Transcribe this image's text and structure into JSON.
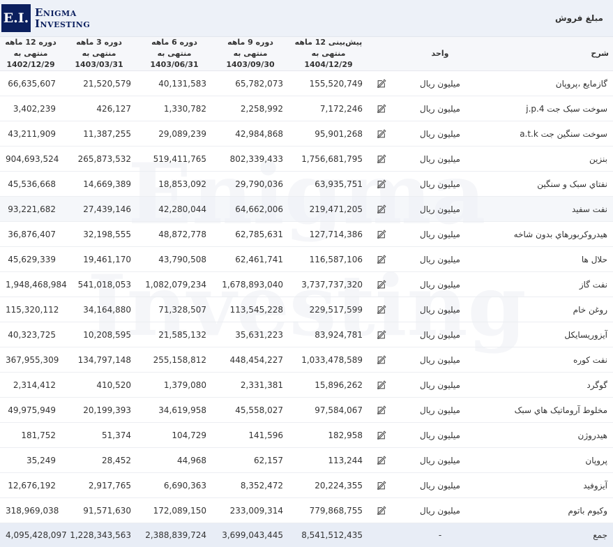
{
  "logo": {
    "box": "E.I.",
    "line1": "Enigma",
    "line2": "Investing"
  },
  "section_title": "مبلغ فروش",
  "columns": {
    "desc": "شرح",
    "unit": "واحد",
    "forecast": "پیش‌بینی 12 ماهه منتهی به 1404/12/29",
    "p9": "دوره 9 ماهه منتهی به 1403/09/30",
    "p6": "دوره 6 ماهه منتهی به 1403/06/31",
    "p3": "دوره 3 ماهه منتهی به 1403/03/31",
    "p12": "دوره 12 ماهه منتهی به 1402/12/29"
  },
  "rows": [
    {
      "desc": "گازمایع ،پروپان",
      "unit": "میلیون ریال",
      "forecast": "155,520,749",
      "p9": "65,782,073",
      "p6": "40,131,583",
      "p3": "21,520,579",
      "p12": "66,635,607"
    },
    {
      "desc": "سوخت سبک جت j.p.4",
      "unit": "میلیون ریال",
      "forecast": "7,172,246",
      "p9": "2,258,992",
      "p6": "1,330,782",
      "p3": "426,127",
      "p12": "3,402,239"
    },
    {
      "desc": "سوخت سنگین جت a.t.k",
      "unit": "میلیون ریال",
      "forecast": "95,901,268",
      "p9": "42,984,868",
      "p6": "29,089,239",
      "p3": "11,387,255",
      "p12": "43,211,909"
    },
    {
      "desc": "بنزین",
      "unit": "میلیون ریال",
      "forecast": "1,756,681,795",
      "p9": "802,339,433",
      "p6": "519,411,765",
      "p3": "265,873,532",
      "p12": "904,693,524"
    },
    {
      "desc": "نفتاي سبک و سنگين",
      "unit": "میلیون ریال",
      "forecast": "63,935,751",
      "p9": "29,790,036",
      "p6": "18,853,092",
      "p3": "14,669,389",
      "p12": "45,536,668"
    },
    {
      "desc": "نفت سفيد",
      "unit": "میلیون ریال",
      "forecast": "219,471,205",
      "p9": "64,662,006",
      "p6": "42,280,044",
      "p3": "27,439,146",
      "p12": "93,221,682"
    },
    {
      "desc": "هيدروکربورهاي بدون شاخه",
      "unit": "میلیون ریال",
      "forecast": "127,714,386",
      "p9": "62,785,631",
      "p6": "48,872,778",
      "p3": "32,198,555",
      "p12": "36,876,407"
    },
    {
      "desc": "حلال ها",
      "unit": "میلیون ریال",
      "forecast": "116,587,106",
      "p9": "62,461,741",
      "p6": "43,790,508",
      "p3": "19,461,170",
      "p12": "45,629,339"
    },
    {
      "desc": "نفت گاز",
      "unit": "میلیون ریال",
      "forecast": "3,737,737,320",
      "p9": "1,678,893,040",
      "p6": "1,082,079,234",
      "p3": "541,018,053",
      "p12": "1,948,468,984"
    },
    {
      "desc": "روغن خام",
      "unit": "میلیون ریال",
      "forecast": "229,517,599",
      "p9": "113,545,228",
      "p6": "71,328,507",
      "p3": "34,164,880",
      "p12": "115,320,112"
    },
    {
      "desc": "آيزوريسايکل",
      "unit": "میلیون ریال",
      "forecast": "83,924,781",
      "p9": "35,631,223",
      "p6": "21,585,132",
      "p3": "10,208,595",
      "p12": "40,323,725"
    },
    {
      "desc": "نفت کوره",
      "unit": "میلیون ریال",
      "forecast": "1,033,478,589",
      "p9": "448,454,227",
      "p6": "255,158,812",
      "p3": "134,797,148",
      "p12": "367,955,309"
    },
    {
      "desc": "گوگرد",
      "unit": "میلیون ریال",
      "forecast": "15,896,262",
      "p9": "2,331,381",
      "p6": "1,379,080",
      "p3": "410,520",
      "p12": "2,314,412"
    },
    {
      "desc": "مخلوط آروماتيک هاي سبک",
      "unit": "میلیون ریال",
      "forecast": "97,584,067",
      "p9": "45,558,027",
      "p6": "34,619,958",
      "p3": "20,199,393",
      "p12": "49,975,949"
    },
    {
      "desc": "هيدروژن",
      "unit": "میلیون ریال",
      "forecast": "182,958",
      "p9": "141,596",
      "p6": "104,729",
      "p3": "51,374",
      "p12": "181,752"
    },
    {
      "desc": "پروپان",
      "unit": "میلیون ریال",
      "forecast": "113,244",
      "p9": "62,157",
      "p6": "44,968",
      "p3": "28,452",
      "p12": "35,249"
    },
    {
      "desc": "آيزوفيد",
      "unit": "میلیون ریال",
      "forecast": "20,224,355",
      "p9": "8,352,472",
      "p6": "6,690,363",
      "p3": "2,917,765",
      "p12": "12,676,192"
    },
    {
      "desc": "وکيوم باتوم",
      "unit": "میلیون ریال",
      "forecast": "779,868,755",
      "p9": "233,009,314",
      "p6": "172,089,150",
      "p3": "91,571,630",
      "p12": "318,969,038"
    }
  ],
  "total": {
    "desc": "جمع",
    "unit": "-",
    "forecast": "8,541,512,435",
    "p9": "3,699,043,445",
    "p6": "2,388,839,724",
    "p3": "1,228,343,563",
    "p12": "4,095,428,097"
  }
}
